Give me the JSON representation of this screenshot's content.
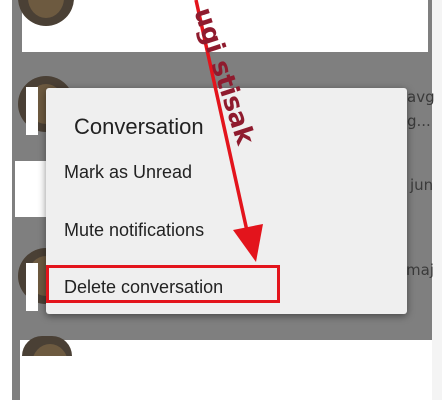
{
  "background_rows": [
    {
      "meta": "avg",
      "sub": "g..."
    },
    {
      "meta": "jun"
    },
    {
      "meta": "maj"
    }
  ],
  "dialog": {
    "title": "Conversation",
    "items": [
      {
        "label": "Mark as Unread"
      },
      {
        "label": "Mute notifications"
      },
      {
        "label": "Delete conversation"
      }
    ]
  },
  "annotation": {
    "text": "ugi stisak",
    "color": "#8f1b2e",
    "arrow_color": "#e3141c"
  }
}
